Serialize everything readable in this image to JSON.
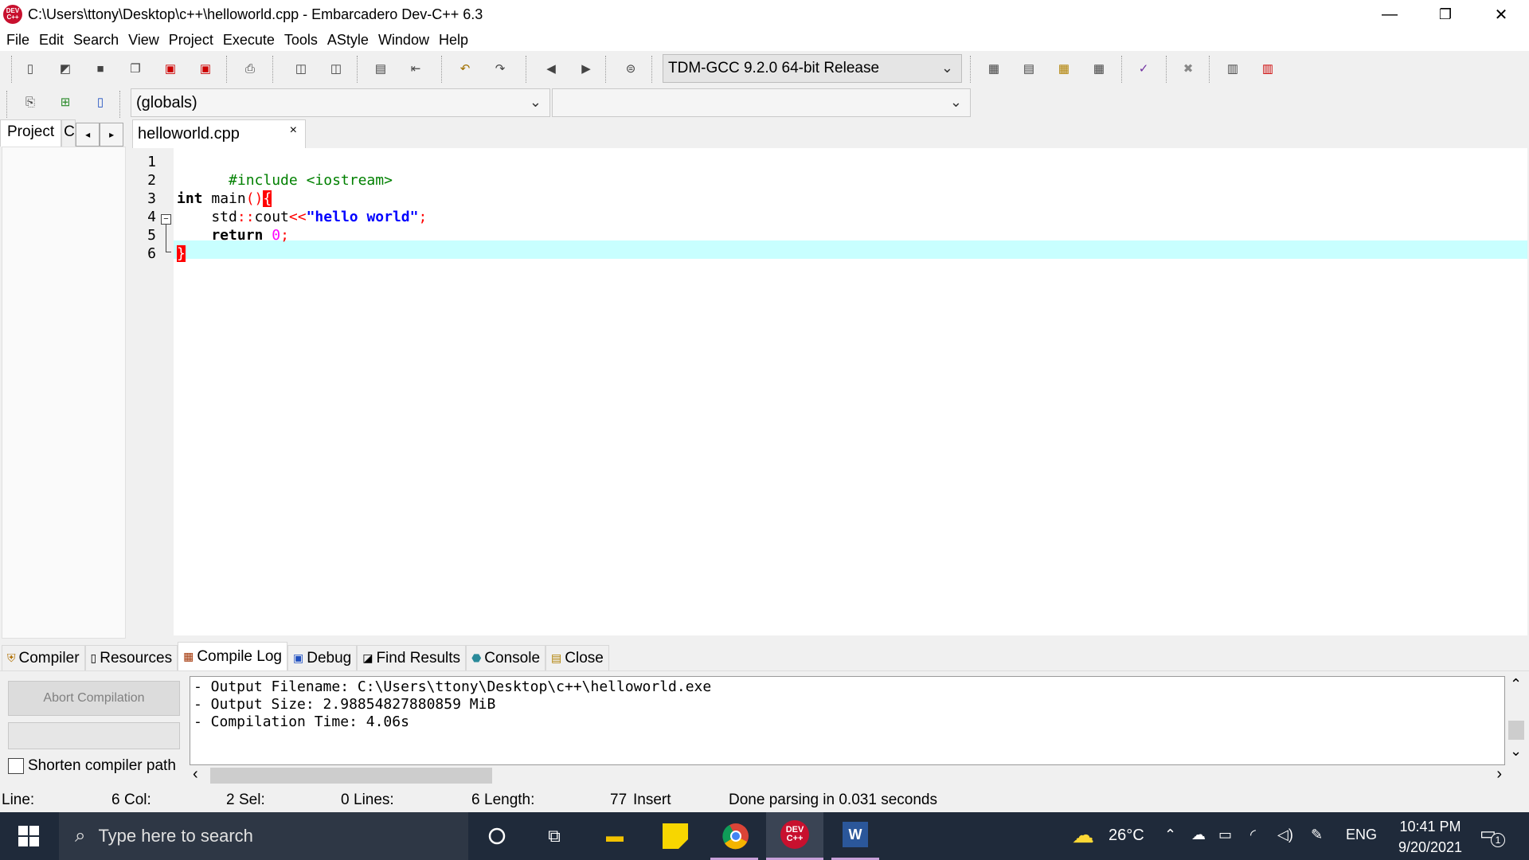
{
  "window": {
    "title": "C:\\Users\\ttony\\Desktop\\c++\\helloworld.cpp - Embarcadero Dev-C++ 6.3",
    "icon_text": "DEV C++",
    "minimize": "—",
    "restore": "❐",
    "close": "✕"
  },
  "menu": [
    "File",
    "Edit",
    "Search",
    "View",
    "Project",
    "Execute",
    "Tools",
    "AStyle",
    "Window",
    "Help"
  ],
  "toolbar": {
    "compiler": "TDM-GCC 9.2.0 64-bit Release",
    "globals": "(globals)",
    "members": ""
  },
  "left_panel": {
    "tab_project": "Project",
    "tab_classes": "C",
    "prev": "◂",
    "next": "▸"
  },
  "editor": {
    "tab_label": "helloworld.cpp",
    "tab_close": "×",
    "line_numbers": [
      "1",
      "2",
      "3",
      "4",
      "5",
      "6"
    ],
    "lines": {
      "l1": "#include <iostream>",
      "l3_kw": "int",
      "l3_name": " main",
      "l3_paren": "()",
      "l3_brace": "{",
      "l4_indent": "    std",
      "l4_op1": "::",
      "l4_cout": "cout",
      "l4_op2": "<<",
      "l4_str": "\"hello world\"",
      "l4_semi": ";",
      "l5_kw": "    return ",
      "l5_num": "0",
      "l5_semi": ";",
      "l6_brace": "}"
    },
    "fold_symbol": "−"
  },
  "bottom_tabs": [
    {
      "icon": "⛨",
      "label": "Compiler"
    },
    {
      "icon": "▯",
      "label": "Resources"
    },
    {
      "icon": "▦",
      "label": "Compile Log"
    },
    {
      "icon": "▣",
      "label": "Debug"
    },
    {
      "icon": "◪",
      "label": "Find Results"
    },
    {
      "icon": "⬣",
      "label": "Console"
    },
    {
      "icon": "▤",
      "label": "Close"
    }
  ],
  "compile_log": {
    "abort_label": "Abort Compilation",
    "shorten_label": "Shorten compiler path",
    "lines": [
      "- Output Filename: C:\\Users\\ttony\\Desktop\\c++\\helloworld.exe",
      "- Output Size: 2.98854827880859 MiB",
      "- Compilation Time: 4.06s"
    ],
    "scroll_up": "⌃",
    "scroll_down": "⌄",
    "scroll_left": "‹",
    "scroll_right": "›",
    "scroll_fraction": 0.18
  },
  "status": {
    "line_label": "Line:",
    "line_val": "6",
    "col_label": "Col:",
    "col_val": "2",
    "sel_label": "Sel:",
    "sel_val": "0",
    "lines_label": "Lines:",
    "lines_val": "6",
    "length_label": "Length:",
    "length_val": "77",
    "mode": "Insert",
    "message": "Done parsing in 0.031 seconds"
  },
  "taskbar": {
    "search_placeholder": "Type here to search",
    "temperature": "26°C",
    "language": "ENG",
    "time": "10:41 PM",
    "date": "9/20/2021",
    "notif_count": "1",
    "devcpp": "DEV C++",
    "word": "W"
  }
}
